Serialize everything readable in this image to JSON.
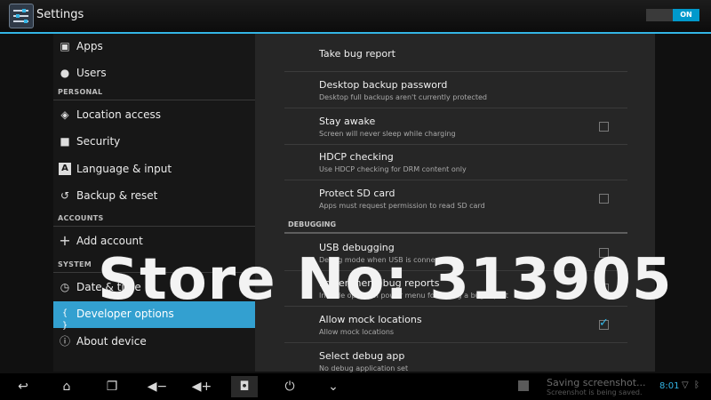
{
  "actionbar": {
    "title": "Settings",
    "toggle_label": "ON",
    "icon": "settings-sliders-icon",
    "accent": "#33b5e5"
  },
  "left_items": [
    {
      "label": "Apps",
      "icon": "apps-icon"
    },
    {
      "label": "Users",
      "icon": "user-icon"
    },
    {
      "label": "Location access",
      "icon": "location-icon"
    },
    {
      "label": "Security",
      "icon": "lock-icon"
    },
    {
      "label": "Language & input",
      "icon": "language-icon"
    },
    {
      "label": "Backup & reset",
      "icon": "restore-icon"
    },
    {
      "label": "Add account",
      "icon": "plus-icon"
    },
    {
      "label": "Date & time",
      "icon": "clock-icon"
    },
    {
      "label": "Developer options",
      "icon": "braces-icon",
      "selected": true
    },
    {
      "label": "About device",
      "icon": "info-icon"
    }
  ],
  "left_headers": {
    "personal": "PERSONAL",
    "accounts": "ACCOUNTS",
    "system": "SYSTEM"
  },
  "right_items": [
    {
      "title": "Take bug report",
      "summary": ""
    },
    {
      "title": "Desktop backup password",
      "summary": "Desktop full backups aren't currently protected"
    },
    {
      "title": "Stay awake",
      "summary": "Screen will never sleep while charging",
      "checked": false
    },
    {
      "title": "HDCP checking",
      "summary": "Use HDCP checking for DRM content only"
    },
    {
      "title": "Protect SD card",
      "summary": "Apps must request permission to read SD card",
      "checked": false
    },
    {
      "title": "USB debugging",
      "summary": "Debug mode when USB is connected",
      "checked": false
    },
    {
      "title": "Power menu bug reports",
      "summary": "Include option in power menu for taking a bug report",
      "checked": false
    },
    {
      "title": "Allow mock locations",
      "summary": "Allow mock locations",
      "checked": true
    },
    {
      "title": "Select debug app",
      "summary": "No debug application set"
    }
  ],
  "right_section": "DEBUGGING",
  "watermark": "Store No: 313905",
  "navbar": {
    "buttons": [
      "back-icon",
      "home-icon",
      "recent-apps-icon",
      "volume-down-icon",
      "volume-up-icon",
      "screenshot-icon",
      "power-icon",
      "collapse-icon"
    ],
    "notification_title": "Saving screenshot...",
    "notification_text": "Screenshot is being saved.",
    "clock": "8:01"
  }
}
